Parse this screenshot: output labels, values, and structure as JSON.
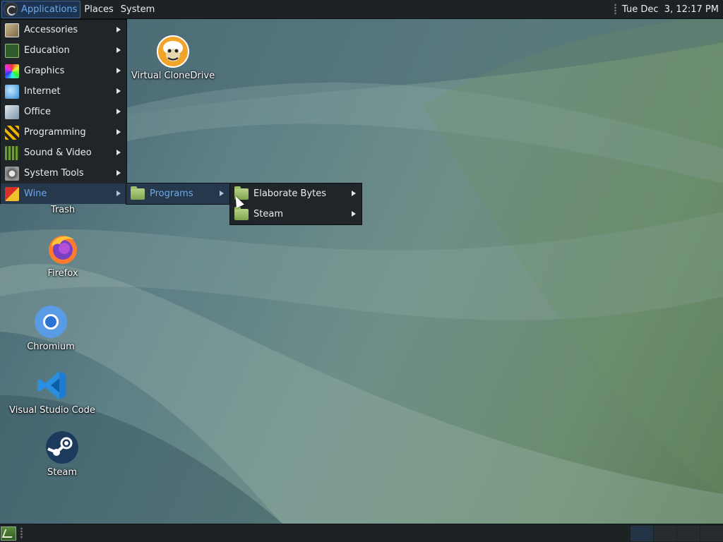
{
  "top_panel": {
    "applications_label": "Applications",
    "places_label": "Places",
    "system_label": "System",
    "clock": "Tue Dec  3, 12:17 PM"
  },
  "desktop_icons": {
    "virtual_clonedrive": "Virtual CloneDrive",
    "trash": "Trash",
    "firefox": "Firefox",
    "chromium": "Chromium",
    "vscode": "Visual Studio Code",
    "steam": "Steam"
  },
  "applications_menu": {
    "items": [
      {
        "label": "Accessories",
        "icon": "accessories-icon"
      },
      {
        "label": "Education",
        "icon": "education-icon"
      },
      {
        "label": "Graphics",
        "icon": "graphics-icon"
      },
      {
        "label": "Internet",
        "icon": "internet-icon"
      },
      {
        "label": "Office",
        "icon": "office-icon"
      },
      {
        "label": "Programming",
        "icon": "programming-icon"
      },
      {
        "label": "Sound & Video",
        "icon": "sound-video-icon"
      },
      {
        "label": "System Tools",
        "icon": "system-tools-icon"
      },
      {
        "label": "Wine",
        "icon": "wine-icon"
      }
    ],
    "highlighted": "Wine"
  },
  "wine_submenu": {
    "items": [
      {
        "label": "Programs",
        "icon": "folder-icon"
      }
    ],
    "highlighted": "Programs"
  },
  "programs_submenu": {
    "items": [
      {
        "label": "Elaborate Bytes",
        "icon": "folder-icon"
      },
      {
        "label": "Steam",
        "icon": "folder-icon"
      }
    ]
  },
  "colors": {
    "panel_bg": "#1d2225",
    "menu_bg": "#1f2528",
    "highlight_bg": "#26384b",
    "highlight_text": "#6fa8e8"
  }
}
